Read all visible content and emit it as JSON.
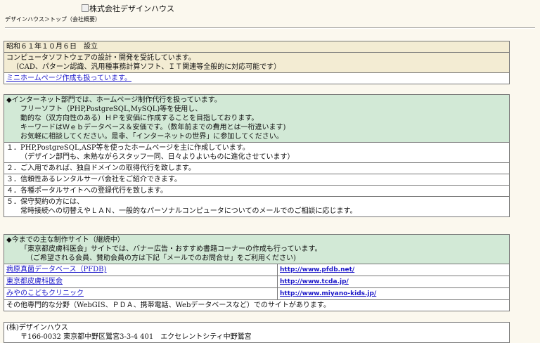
{
  "header": {
    "logo_alt": "株式会社デザインハウス",
    "breadcrumb": "デザインハウス＞トップ（会社概要）"
  },
  "company": {
    "founded": "昭和６１年１０月６日　設立",
    "business_line1": "コンピュータソフトウェアの設計・開発を受託しています。",
    "business_line2": "（CAD、パターン認識、汎用種事務計算ソフト、ＩＴ関連等全般的に対応可能です）",
    "homepage_link": "ミニホームページ作成も扱っています。"
  },
  "internet": {
    "lines": [
      "◆インターネット部門では、ホームページ制作代行を扱っています。",
      "フリーソフト（PHP,PostgreSQL,MySQL)等を使用し、",
      "動的な（双方向性のある）ＨＰを安価に作成することを目指しております。",
      "キーワードはＷｅｂデータベース＆安価です。（数年前までの費用とは一桁違います)",
      "お気軽に相談してください。是非、「インターネットの世界」に参加してください。"
    ],
    "items": [
      {
        "main": "１．PHP,PostgreSQL,ASP等を使ったホームページを主に作成しています。",
        "sub": "（デザイン部門も、未熟ながらスタッフ一同、日々よりよいものに進化させています）"
      },
      {
        "main": "２．ご入用であれば、独自ドメインの取得代行を致します。",
        "sub": ""
      },
      {
        "main": "３．信頼性あるレンタルサーバ会社をご紹介できます。",
        "sub": ""
      },
      {
        "main": "４．各種ポータルサイトへの登録代行を致します。",
        "sub": ""
      },
      {
        "main": "５．保守契約の方には、",
        "sub": "常時接続への切替えやＬＡＮ、一般的なパーソナルコンピュータについてのメールでのご相談に応じます。"
      }
    ]
  },
  "works": {
    "lines": [
      "◆今までの主な制作サイト（継続中）",
      "「東京都皮膚科医会」サイトでは、バナー広告・おすすめ書籍コーナーの作成も行っています。",
      "（ご希望される会員、賛助会員の方は下記「メールでのお問合せ」をご利用ください)"
    ],
    "sites": [
      {
        "name": "病原真菌データベース（PFDB)",
        "url": "http://www.pfdb.net/"
      },
      {
        "name": "東京都皮膚科医会",
        "url": "http://www.tcda.jp/"
      },
      {
        "name": "みやのこどもクリニック",
        "url": "http://www.miyano-kids.jp/"
      }
    ],
    "other": "その他専門的な分野（WebGIS、ＰＤＡ、携帯電話、Webデータベースなど）でのサイトがあります。"
  },
  "contact": {
    "company": "(株)デザインハウス",
    "address_partial": "〒166-0032 東京都中野区鷺宮3-3-4 401　エクセレントシティ中野鷺宮"
  }
}
